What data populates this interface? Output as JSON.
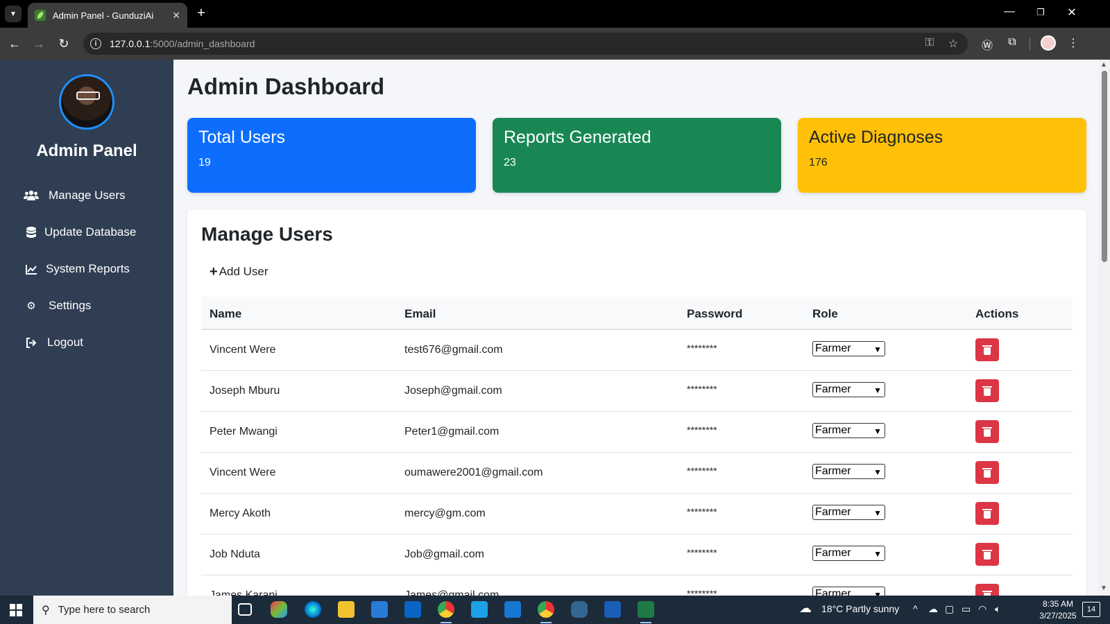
{
  "browser": {
    "tab_title": "Admin Panel - GunduziAi",
    "url_host": "127.0.0.1",
    "url_path": ":5000/admin_dashboard"
  },
  "sidebar": {
    "title": "Admin Panel",
    "items": [
      {
        "label": "Manage Users",
        "icon": "users-icon"
      },
      {
        "label": "Update Database",
        "icon": "database-icon"
      },
      {
        "label": "System Reports",
        "icon": "chart-line-icon"
      },
      {
        "label": "Settings",
        "icon": "gears-icon"
      },
      {
        "label": "Logout",
        "icon": "sign-out-icon"
      }
    ]
  },
  "main": {
    "title": "Admin Dashboard",
    "cards": [
      {
        "title": "Total Users",
        "value": "19",
        "color": "#0d6efd"
      },
      {
        "title": "Reports Generated",
        "value": "23",
        "color": "#198754"
      },
      {
        "title": "Active Diagnoses",
        "value": "176",
        "color": "#ffc107"
      }
    ]
  },
  "manage_users": {
    "title": "Manage Users",
    "add_label": "Add User",
    "columns": [
      "Name",
      "Email",
      "Password",
      "Role",
      "Actions"
    ],
    "rows": [
      {
        "name": "Vincent Were",
        "email": "test676@gmail.com",
        "password": "********",
        "role": "Farmer"
      },
      {
        "name": "Joseph Mburu",
        "email": "Joseph@gmail.com",
        "password": "********",
        "role": "Farmer"
      },
      {
        "name": "Peter Mwangi",
        "email": "Peter1@gmail.com",
        "password": "********",
        "role": "Farmer"
      },
      {
        "name": "Vincent Were",
        "email": "oumawere2001@gmail.com",
        "password": "********",
        "role": "Farmer"
      },
      {
        "name": "Mercy Akoth",
        "email": "mercy@gm.com",
        "password": "********",
        "role": "Farmer"
      },
      {
        "name": "Job Nduta",
        "email": "Job@gmail.com",
        "password": "********",
        "role": "Farmer"
      },
      {
        "name": "James Karani",
        "email": "James@gmail.com",
        "password": "********",
        "role": "Farmer"
      }
    ]
  },
  "taskbar": {
    "search_placeholder": "Type here to search",
    "weather": "18°C  Partly sunny",
    "time": "8:35 AM",
    "date": "3/27/2025",
    "notifications": "14"
  }
}
